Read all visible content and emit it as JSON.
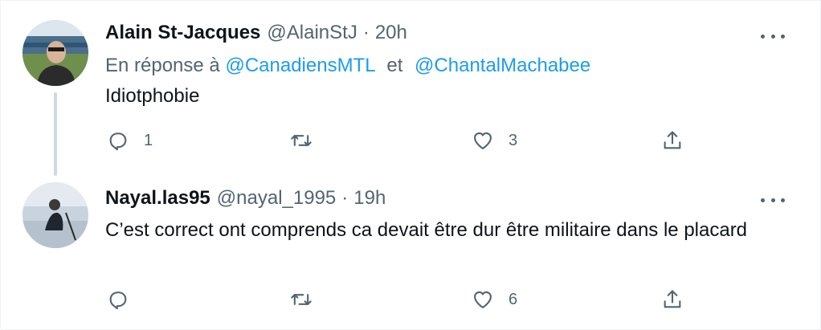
{
  "tweets": [
    {
      "author_name": "Alain St-Jacques",
      "handle": "@AlainStJ",
      "separator": "·",
      "time": "20h",
      "reply_prefix": "En réponse à",
      "reply_mention_1": "@CanadiensMTL",
      "reply_joiner": "et",
      "reply_mention_2": "@ChantalMachabee",
      "text": "Idiotphobie",
      "reply_count": "1",
      "retweet_count": "",
      "like_count": "3"
    },
    {
      "author_name": "Nayal.las95",
      "handle": "@nayal_1995",
      "separator": "·",
      "time": "19h",
      "text": "C’est correct ont comprends ca devait être dur être militaire dans le placard",
      "reply_count": "",
      "retweet_count": "",
      "like_count": "6"
    }
  ],
  "icons": {
    "reply": "reply-icon",
    "retweet": "retweet-icon",
    "like": "heart-icon",
    "share": "share-icon",
    "more": "more-icon"
  },
  "colors": {
    "text_primary": "#0f1419",
    "text_secondary": "#536471",
    "link": "#1d9bf0",
    "thread_line": "#cfd9de"
  }
}
